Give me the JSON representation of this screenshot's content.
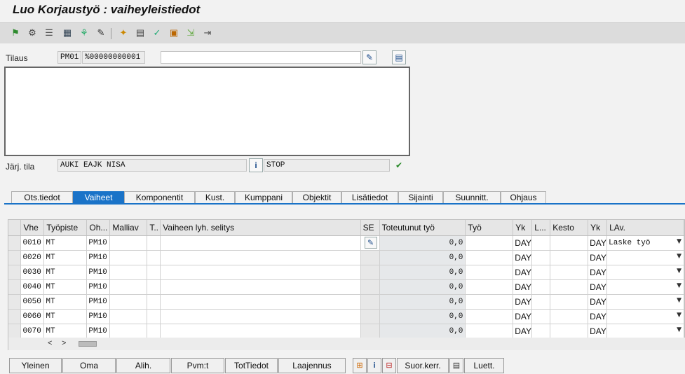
{
  "window": {
    "title": "Luo Korjaustyö : vaiheyleistiedot"
  },
  "toolbar_icons": [
    "flag-icon",
    "settings-icon",
    "list-icon",
    "calculator-icon",
    "hierarchy-icon",
    "edit-icon",
    "cost-icon",
    "document-icon",
    "approve-icon",
    "print-icon",
    "export-icon"
  ],
  "order": {
    "label": "Tilaus",
    "type": "PM01",
    "number": "%00000000001",
    "description": ""
  },
  "status": {
    "label": "Järj. tila",
    "system_status": "AUKI EAJK NISA",
    "user_status": "STOP"
  },
  "tabs": [
    {
      "label": "Ots.tiedot"
    },
    {
      "label": "Vaiheet"
    },
    {
      "label": "Komponentit"
    },
    {
      "label": "Kust."
    },
    {
      "label": "Kumppani"
    },
    {
      "label": "Objektit"
    },
    {
      "label": "Lisätiedot"
    },
    {
      "label": "Sijainti"
    },
    {
      "label": "Suunnitt."
    },
    {
      "label": "Ohjaus"
    }
  ],
  "active_tab": "Vaiheet",
  "operations": {
    "columns": [
      "Vhe",
      "Työpiste",
      "Oh...",
      "Malliav",
      "T..",
      "Vaiheen lyh. selitys",
      "SE",
      "Toteutunut työ",
      "Työ",
      "Yk",
      "L...",
      "Kesto",
      "Yk",
      "LAv."
    ],
    "rows": [
      {
        "vhe": "0010",
        "tyopiste": "MT",
        "oh": "PM10",
        "toteutunut": "0,0",
        "yk": "DAY",
        "yk2": "DAY",
        "lav": "Laske työ"
      },
      {
        "vhe": "0020",
        "tyopiste": "MT",
        "oh": "PM10",
        "toteutunut": "0,0",
        "yk": "DAY",
        "yk2": "DAY",
        "lav": ""
      },
      {
        "vhe": "0030",
        "tyopiste": "MT",
        "oh": "PM10",
        "toteutunut": "0,0",
        "yk": "DAY",
        "yk2": "DAY",
        "lav": ""
      },
      {
        "vhe": "0040",
        "tyopiste": "MT",
        "oh": "PM10",
        "toteutunut": "0,0",
        "yk": "DAY",
        "yk2": "DAY",
        "lav": ""
      },
      {
        "vhe": "0050",
        "tyopiste": "MT",
        "oh": "PM10",
        "toteutunut": "0,0",
        "yk": "DAY",
        "yk2": "DAY",
        "lav": ""
      },
      {
        "vhe": "0060",
        "tyopiste": "MT",
        "oh": "PM10",
        "toteutunut": "0,0",
        "yk": "DAY",
        "yk2": "DAY",
        "lav": ""
      },
      {
        "vhe": "0070",
        "tyopiste": "MT",
        "oh": "PM10",
        "toteutunut": "0,0",
        "yk": "DAY",
        "yk2": "DAY",
        "lav": ""
      }
    ]
  },
  "bottom_buttons": {
    "yleinen": "Yleinen",
    "oma": "Oma",
    "alih": "Alih.",
    "pvm": "Pvm:t",
    "tottiedot": "TotTiedot",
    "laajennus": "Laajennus",
    "suor": "Suor.kerr.",
    "luett": "Luett."
  }
}
